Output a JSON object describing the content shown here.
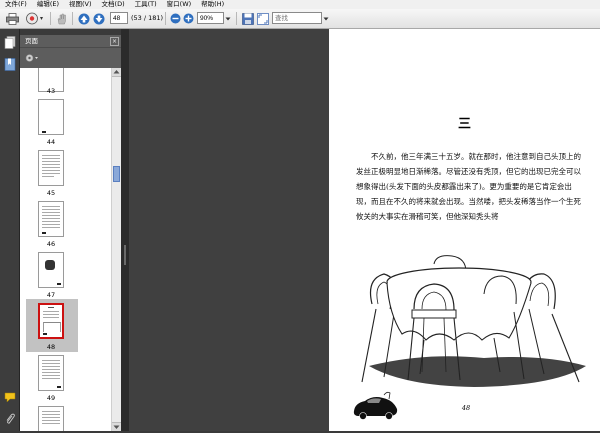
{
  "menu": [
    "文件(F)",
    "编辑(E)",
    "视图(V)",
    "文档(D)",
    "工具(T)",
    "窗口(W)",
    "帮助(H)"
  ],
  "toolbar": {
    "page_value": "48",
    "page_count": "(53 / 181)",
    "zoom_value": "90%",
    "search_placeholder": "查找"
  },
  "panel": {
    "title": "页面",
    "close_glyph": "×",
    "thumbnails": [
      {
        "label": "43"
      },
      {
        "label": "44"
      },
      {
        "label": "45"
      },
      {
        "label": "46"
      },
      {
        "label": "47"
      },
      {
        "label": "48",
        "selected": true
      },
      {
        "label": "49"
      }
    ]
  },
  "document": {
    "chapter": "三",
    "paragraph": "不久前，他三年满三十五岁。就在那时，他注意到自己头顶上的发丝正极明显地日渐稀落。尽管还没有秃顶，但它的出现已完全可以想象得出(头发下面的头皮都露出来了)。更为重要的是它肯定会出现，而且在不久的将来就会出现。当然喽，把头发稀落当作一个生死攸关的大事实在滑稽可笑，但他深知秃头将",
    "page_number": "48"
  },
  "icons": {
    "print": "printer-icon",
    "email": "email-icon",
    "hand": "hand-tool-icon",
    "up": "arrow-up-icon",
    "down": "arrow-down-icon",
    "zoom_out": "zoom-out-icon",
    "zoom_in": "zoom-in-icon",
    "save": "save-icon",
    "fit": "fit-page-icon"
  }
}
